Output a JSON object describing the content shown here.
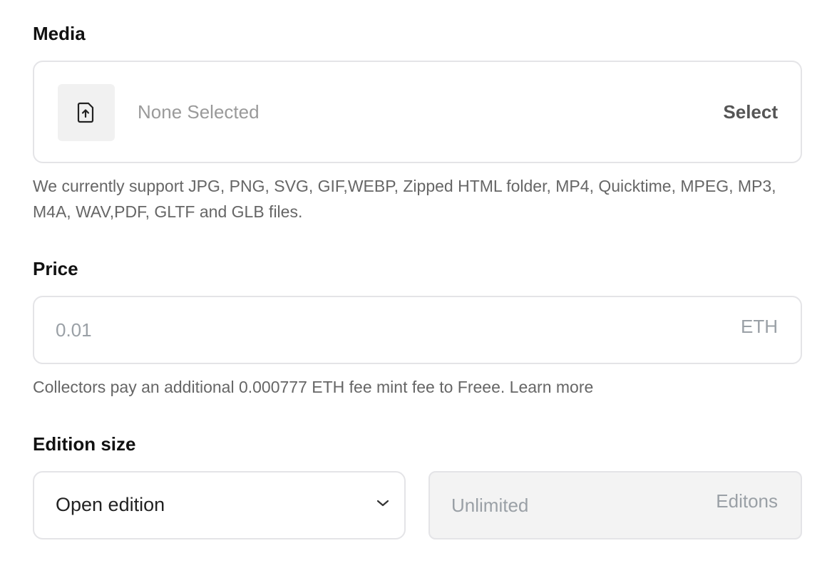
{
  "media": {
    "label": "Media",
    "placeholder": "None Selected",
    "select_label": "Select",
    "help": "We currently support JPG, PNG, SVG, GIF,WEBP, Zipped HTML folder, MP4, Quicktime, MPEG, MP3, M4A, WAV,PDF, GLTF and GLB files."
  },
  "price": {
    "label": "Price",
    "placeholder": "0.01",
    "unit": "ETH",
    "help": "Collectors pay an additional 0.000777 ETH fee mint fee to Freee. Learn more"
  },
  "edition": {
    "label": "Edition size",
    "selected": "Open edition",
    "amount_placeholder": "Unlimited",
    "amount_unit": "Editons"
  },
  "icons": {
    "upload": "file-upload-icon",
    "chevron": "chevron-down-icon"
  }
}
